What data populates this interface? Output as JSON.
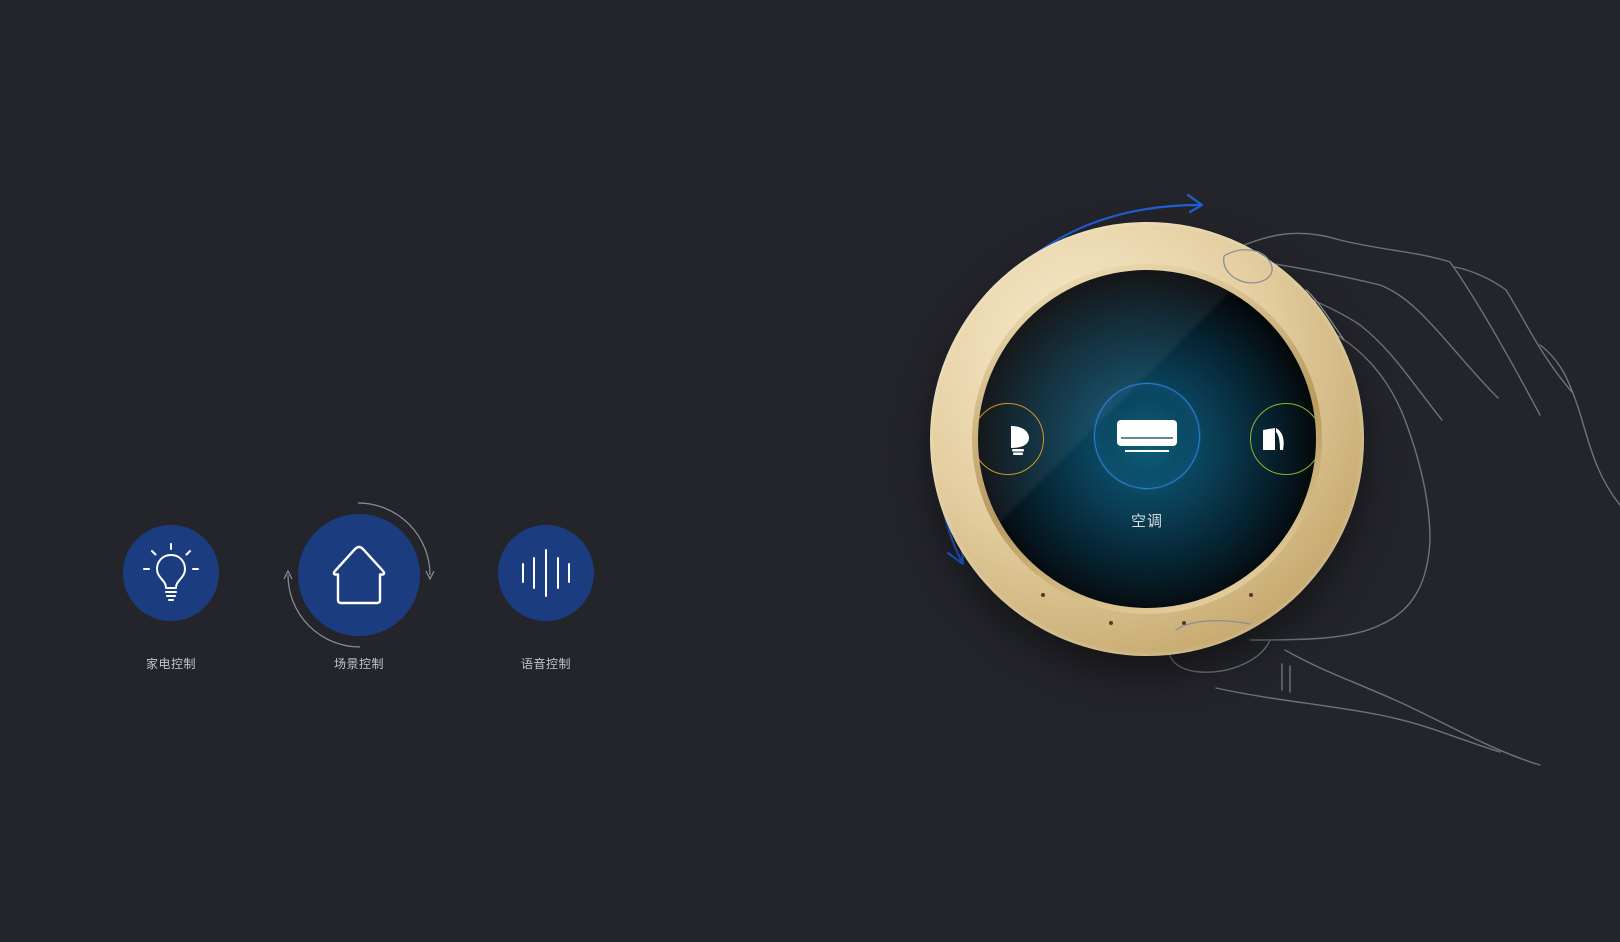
{
  "features": [
    {
      "id": "appliance",
      "label": "家电控制",
      "icon": "lightbulb-icon",
      "active": false
    },
    {
      "id": "scene",
      "label": "场景控制",
      "icon": "house-icon",
      "active": true
    },
    {
      "id": "voice",
      "label": "语音控制",
      "icon": "voice-wave-icon",
      "active": false
    }
  ],
  "device": {
    "screen_label": "空调",
    "center_icon": "air-conditioner-icon",
    "left_icon": "lightbulb-icon",
    "right_icon": "curtain-icon"
  },
  "colors": {
    "background": "#24252b",
    "feature_disc": "#1b3d80",
    "rotate_arrow": "#1f5fd6",
    "bezel_gold": "#e4cea0",
    "screen_accent": "#2b7fd6",
    "left_ring": "#d59422",
    "right_ring": "#89b52b"
  }
}
